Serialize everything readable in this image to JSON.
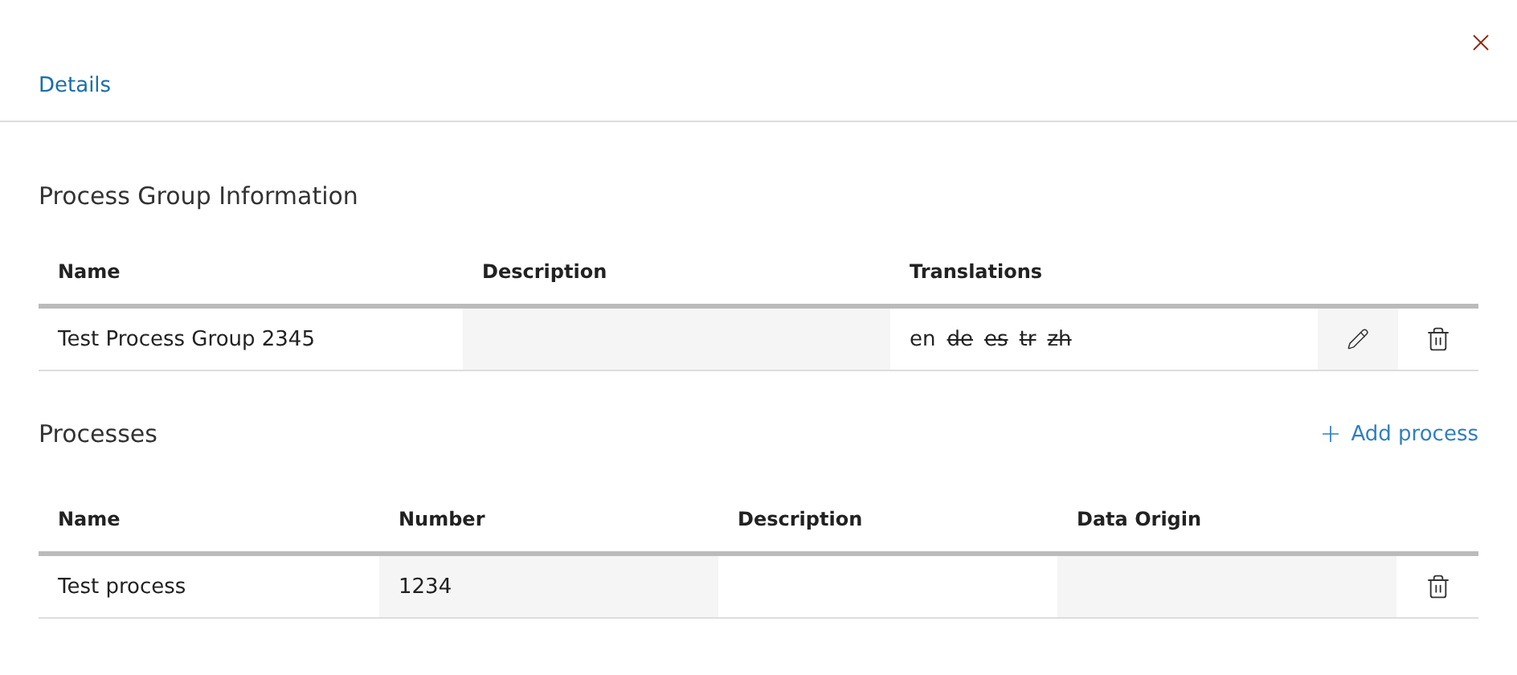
{
  "tabs": [
    {
      "label": "Details",
      "selected": true
    }
  ],
  "group_section": {
    "title": "Process Group Information",
    "columns": [
      "Name",
      "Description",
      "Translations"
    ],
    "rows": [
      {
        "name": "Test Process Group 2345",
        "description": "",
        "translations": [
          {
            "code": "en",
            "available": true
          },
          {
            "code": "de",
            "available": false
          },
          {
            "code": "es",
            "available": false
          },
          {
            "code": "tr",
            "available": false
          },
          {
            "code": "zh",
            "available": false
          }
        ]
      }
    ]
  },
  "process_section": {
    "title": "Processes",
    "add_label": "Add process",
    "columns": [
      "Name",
      "Number",
      "Description",
      "Data Origin"
    ],
    "rows": [
      {
        "name": "Test process",
        "number": "1234",
        "description": "",
        "data_origin": ""
      }
    ]
  }
}
